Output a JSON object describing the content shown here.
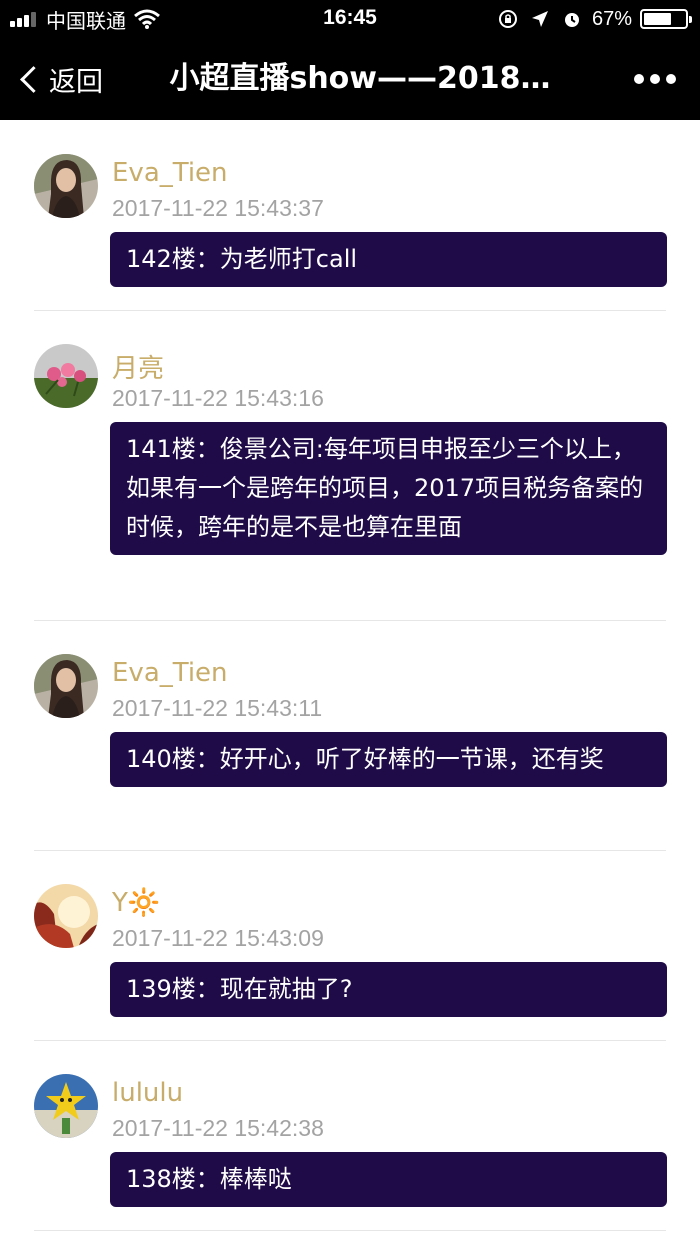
{
  "status_bar": {
    "carrier": "中国联通",
    "time": "16:45",
    "battery": "67%",
    "battery_level": 0.67,
    "icons": [
      "signal-icon",
      "wifi-icon",
      "lock-rotation-icon",
      "location-icon",
      "alarm-icon",
      "battery-icon"
    ]
  },
  "nav": {
    "back_label": "返回",
    "title": "小超直播show——2018…",
    "more_icon": "more-dots-icon"
  },
  "colors": {
    "bubble": "#1e0b47",
    "username": "#c8ac6a",
    "timestamp": "#a3a3a3",
    "bar": "#000000"
  },
  "comments": [
    {
      "username": "Eva_Tien",
      "timestamp": "2017-11-22 15:43:37",
      "text": "142楼：为老师打call",
      "avatar": "avatar-woman-portrait"
    },
    {
      "username": "月亮",
      "timestamp": "2017-11-22 15:43:16",
      "text": "141楼：俊景公司:每年项目申报至少三个以上，如果有一个是跨年的项目，2017项目税务备案的时候，跨年的是不是也算在里面",
      "avatar": "avatar-flowers"
    },
    {
      "username": "Eva_Tien",
      "timestamp": "2017-11-22 15:43:11",
      "text": "140楼：好开心，听了好棒的一节课，还有奖",
      "avatar": "avatar-woman-portrait"
    },
    {
      "username": "Y🔆",
      "timestamp": "2017-11-22 15:43:09",
      "text": "139楼：现在就抽了?",
      "avatar": "avatar-sunset-leaves"
    },
    {
      "username": "lululu",
      "timestamp": "2017-11-22 15:42:38",
      "text": "138楼：棒棒哒",
      "avatar": "avatar-yellow-star"
    }
  ]
}
